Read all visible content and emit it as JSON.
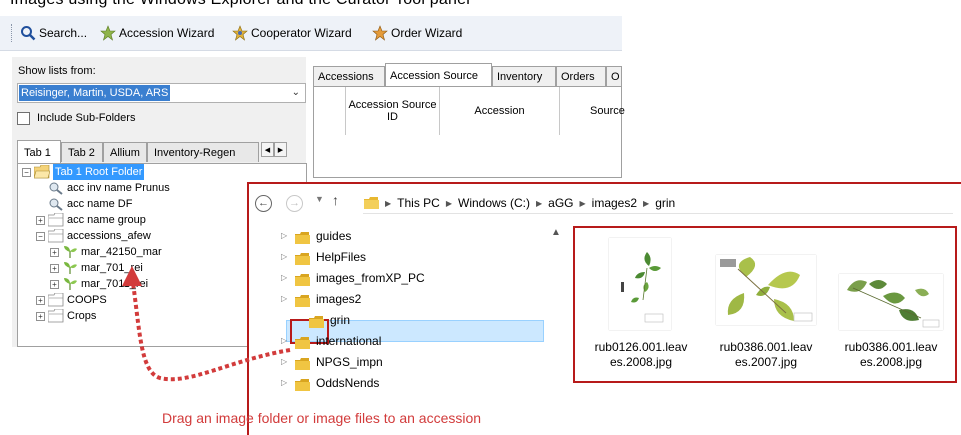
{
  "cutoff_text": "Images using the Windows Explorer and the Curator Tool panel",
  "toolbar": {
    "items": [
      {
        "label": "Search...",
        "icon": "search-icon"
      },
      {
        "label": "Accession Wizard",
        "icon": "accession-wizard-icon"
      },
      {
        "label": "Cooperator Wizard",
        "icon": "cooperator-wizard-icon"
      },
      {
        "label": "Order Wizard",
        "icon": "order-wizard-icon"
      }
    ]
  },
  "left": {
    "show_lists_label": "Show lists from:",
    "combo_value": "Reisinger, Martin, USDA, ARS",
    "include_subfolders": "Include Sub-Folders",
    "tabs": [
      "Tab 1",
      "Tab 2",
      "Allium",
      "Inventory-Regen"
    ],
    "tree": [
      {
        "label": "Tab 1 Root Folder",
        "level": 0,
        "expander": "-",
        "icon": "folder-open-icon",
        "selected": true
      },
      {
        "label": "acc inv name Prunus",
        "level": 1,
        "expander": "",
        "icon": "query-icon"
      },
      {
        "label": "acc name DF",
        "level": 1,
        "expander": "",
        "icon": "query-icon"
      },
      {
        "label": "acc name group",
        "level": 1,
        "expander": "+",
        "icon": "folder-icon"
      },
      {
        "label": "accessions_afew",
        "level": 1,
        "expander": "-",
        "icon": "folder-icon"
      },
      {
        "label": "mar_42150_mar",
        "level": 2,
        "expander": "+",
        "icon": "plant-icon"
      },
      {
        "label": "mar_701_rei",
        "level": 2,
        "expander": "+",
        "icon": "plant-icon"
      },
      {
        "label": "mar_7011_rei",
        "level": 2,
        "expander": "+",
        "icon": "plant-icon"
      },
      {
        "label": "COOPS",
        "level": 1,
        "expander": "+",
        "icon": "folder-icon"
      },
      {
        "label": "Crops",
        "level": 1,
        "expander": "+",
        "icon": "folder-icon"
      }
    ]
  },
  "right": {
    "tabs": [
      "Accessions",
      "Accession Source",
      "Inventory",
      "Orders",
      "O"
    ],
    "active_tab": 1,
    "columns": [
      "Accession Source ID",
      "Accession",
      "Source"
    ]
  },
  "explorer": {
    "breadcrumb": [
      "This PC",
      "Windows (C:)",
      "aGG",
      "images2",
      "grin"
    ],
    "folders": [
      {
        "label": "guides",
        "indent": 0
      },
      {
        "label": "HelpFiles",
        "indent": 0
      },
      {
        "label": "images_fromXP_PC",
        "indent": 0
      },
      {
        "label": "images2",
        "indent": 0
      },
      {
        "label": "grin",
        "indent": 1,
        "selected": true
      },
      {
        "label": "international",
        "indent": 0
      },
      {
        "label": "NPGS_impn",
        "indent": 0
      },
      {
        "label": "OddsNends",
        "indent": 0
      }
    ],
    "files": [
      {
        "name": "rub0126.001.leaves.2008.jpg",
        "line1": "rub0126.001.leav",
        "line2": "es.2008.jpg"
      },
      {
        "name": "rub0386.001.leaves.2007.jpg",
        "line1": "rub0386.001.leav",
        "line2": "es.2007.jpg"
      },
      {
        "name": "rub0386.001.leaves.2008.jpg",
        "line1": "rub0386.001.leav",
        "line2": "es.2008.jpg"
      }
    ]
  },
  "caption": "Drag an image folder or image files to an accession",
  "colors": {
    "annotation_red": "#b71a1a",
    "caption_red": "#d23b3b",
    "tree_selection": "#3399ff",
    "folder_yellow": "#e8b830"
  }
}
